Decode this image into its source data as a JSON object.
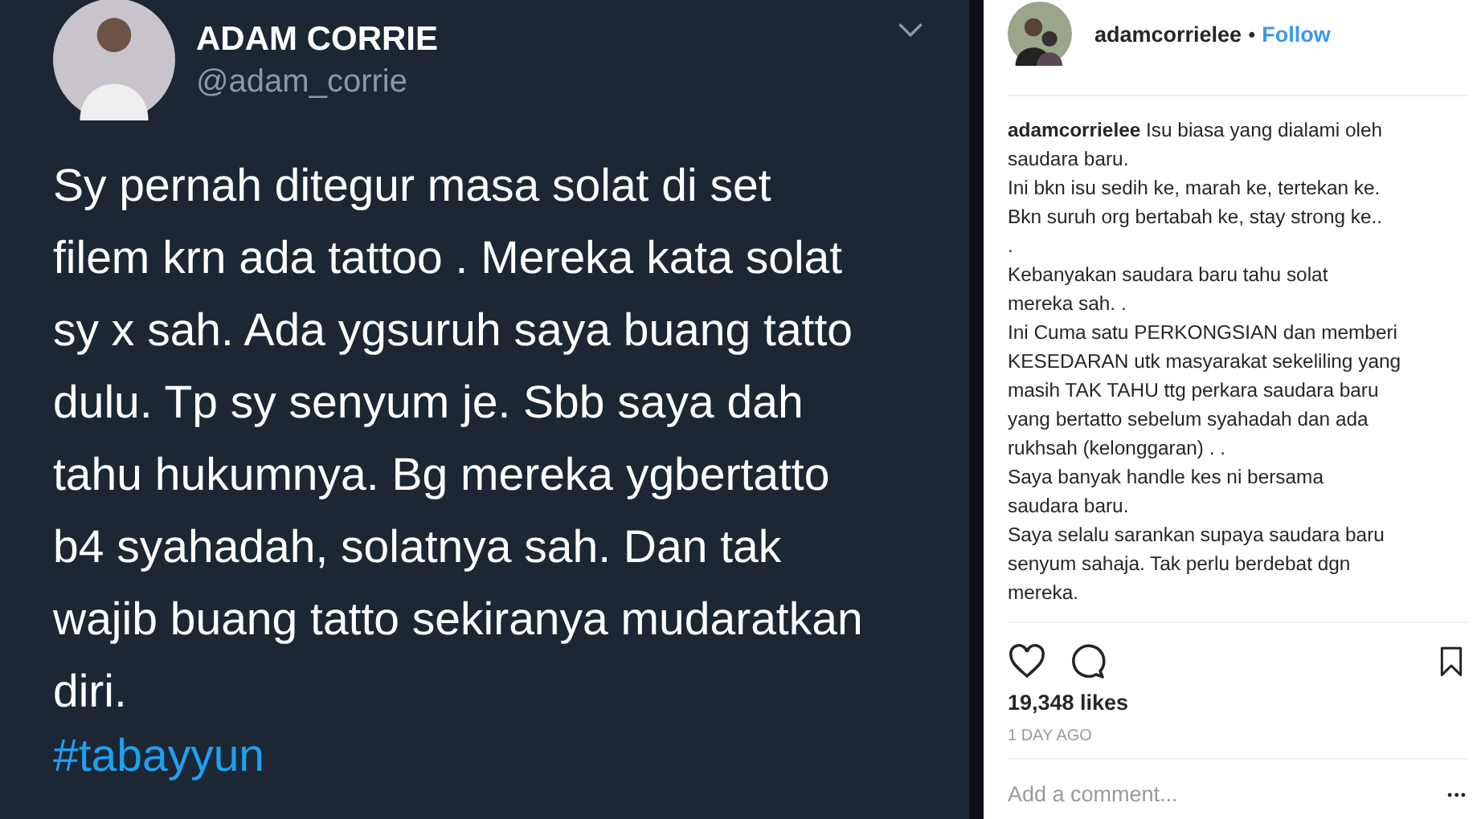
{
  "tweet": {
    "name": "ADAM CORRIE",
    "handle": "@adam_corrie",
    "text": "Sy pernah ditegur masa solat di set\nfilem krn ada tattoo . Mereka kata solat\nsy x sah. Ada ygsuruh saya buang tatto\ndulu. Tp sy senyum je. Sbb saya dah\ntahu hukumnya. Bg mereka ygbertatto\nb4 syahadah, solatnya sah. Dan tak\nwajib buang tatto sekiranya mudaratkan\ndiri.",
    "hashtag": "#tabayyun"
  },
  "post": {
    "username": "adamcorrielee",
    "separator": "•",
    "follow": "Follow",
    "caption": "**adamcorrielee** Isu biasa yang dialami oleh\nsaudara baru.\nIni bkn isu sedih ke, marah ke, tertekan ke.\nBkn suruh org bertabah ke, stay strong ke..\n.\nKebanyakan saudara baru tahu solat\nmereka sah. .\nIni Cuma satu PERKONGSIAN dan memberi\nKESEDARAN utk masyarakat sekeliling yang\nmasih TAK TAHU ttg perkara saudara baru\nyang bertatto sebelum syahadah dan ada\nrukhsah (kelonggaran) . .\nSaya banyak handle kes ni bersama\nsaudara baru.\nSaya selalu sarankan supaya saudara baru\nsenyum sahaja. Tak perlu berdebat dgn\nmereka.",
    "likes": "19,348 likes",
    "time": "1 DAY AGO",
    "comment_placeholder": "Add a comment...",
    "more": "•••"
  }
}
